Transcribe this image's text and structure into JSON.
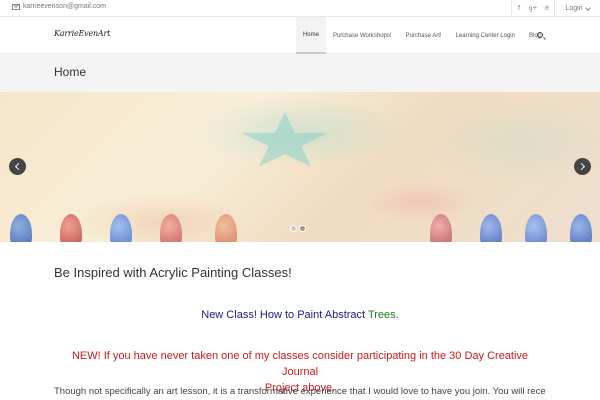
{
  "topbar": {
    "email": "karrieevenson@gmail.com",
    "social_icons": [
      "facebook-icon",
      "google-plus-icon",
      "pinterest-icon"
    ],
    "login_label": "Login"
  },
  "header": {
    "logo_text": "KarrieEvenArt",
    "nav": [
      {
        "label": "Home",
        "active": true
      },
      {
        "label": "Purchase Workshops!",
        "active": false
      },
      {
        "label": "Purchase Art!",
        "active": false
      },
      {
        "label": "Learning Center Login",
        "active": false
      },
      {
        "label": "Blog",
        "active": false
      }
    ]
  },
  "page_title": "Home",
  "slider": {
    "slide_count": 2,
    "active_slide": 1
  },
  "content": {
    "heading": "Be Inspired with Acrylic Painting Classes!",
    "new_class_prefix": "New Class! How to Paint Abstract ",
    "new_class_highlight": "Trees",
    "new_class_suffix": ".",
    "promo_line1": "NEW! If you have never taken one of my classes consider participating in the 30 Day Creative Journal",
    "promo_line2": "Project above.",
    "body_text": "Though not specifically an art lesson, it is a transformative experience that I would love to have you join. You will receive"
  },
  "colors": {
    "new_class_text": "#1a1a8a",
    "highlight_green": "#1a7a1a",
    "promo_red": "#cc1a1a"
  }
}
